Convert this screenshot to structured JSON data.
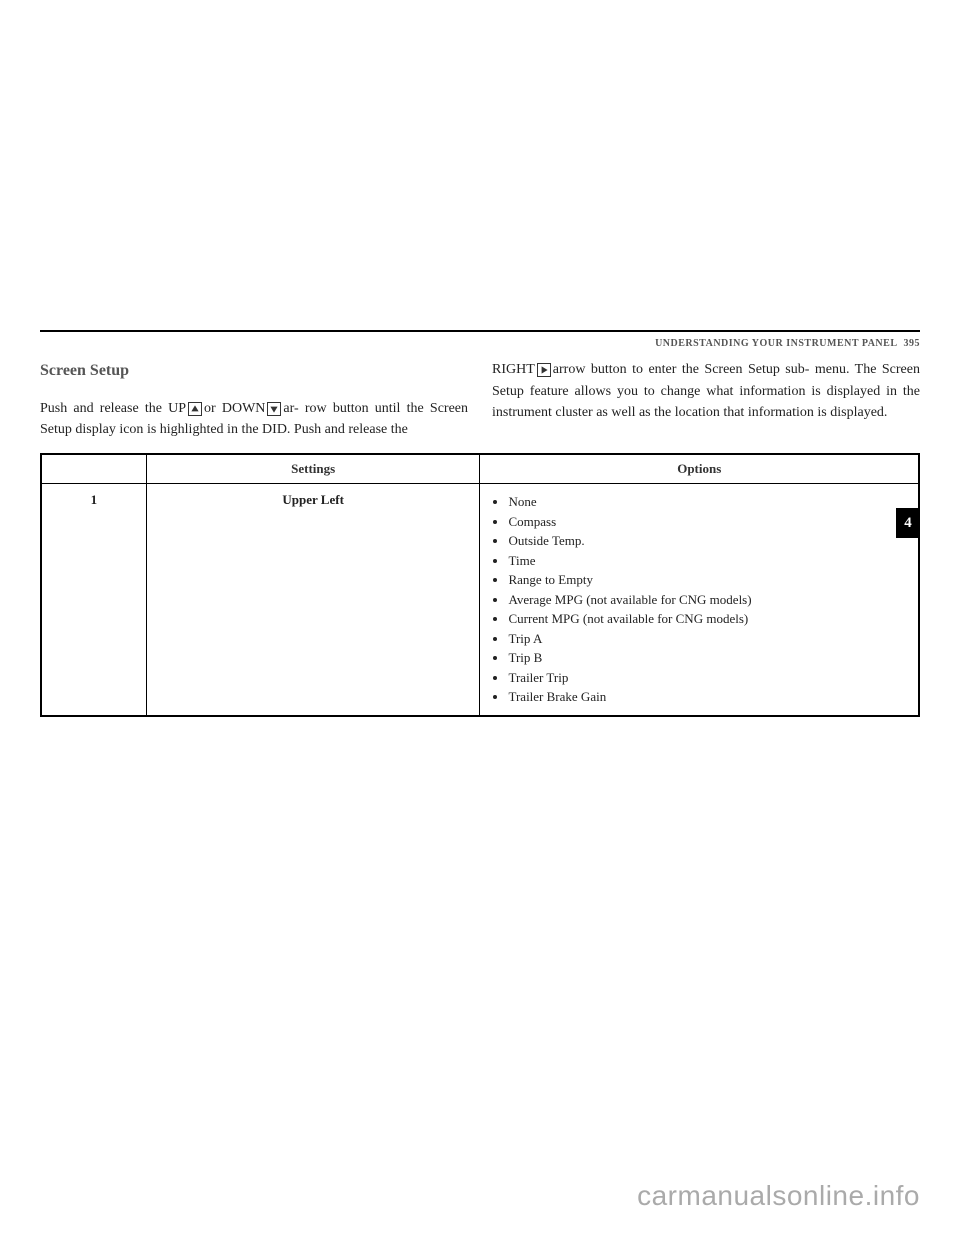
{
  "header": {
    "running_head": "UNDERSTANDING YOUR INSTRUMENT PANEL",
    "page_number": "395"
  },
  "section_title": "Screen Setup",
  "left_col": {
    "l1a": "Push and release the UP",
    "l1b": "or DOWN",
    "l1c": "ar-",
    "l2": "row button until the Screen Setup display icon",
    "l3": "is highlighted in the DID. Push and release the"
  },
  "right_col": {
    "r1a": "RIGHT",
    "r1b": "arrow button to enter the Screen Setup sub-",
    "r2": "menu. The Screen Setup feature allows you to change",
    "r3": "what information is displayed in the instrument cluster",
    "r4": "as well as the location that information is displayed."
  },
  "table": {
    "headers": {
      "c1": "",
      "c2": "Settings",
      "c3": "Options"
    },
    "row": {
      "num": "1",
      "setting": "Upper Left",
      "options": [
        "None",
        "Compass",
        "Outside Temp.",
        "Time",
        "Range to Empty",
        "Average MPG (not available for CNG models)",
        "Current MPG (not available for CNG models)",
        "Trip A",
        "Trip B",
        "Trailer Trip",
        "Trailer Brake Gain"
      ]
    }
  },
  "side_tab": "4",
  "watermark": "carmanualsonline.info"
}
